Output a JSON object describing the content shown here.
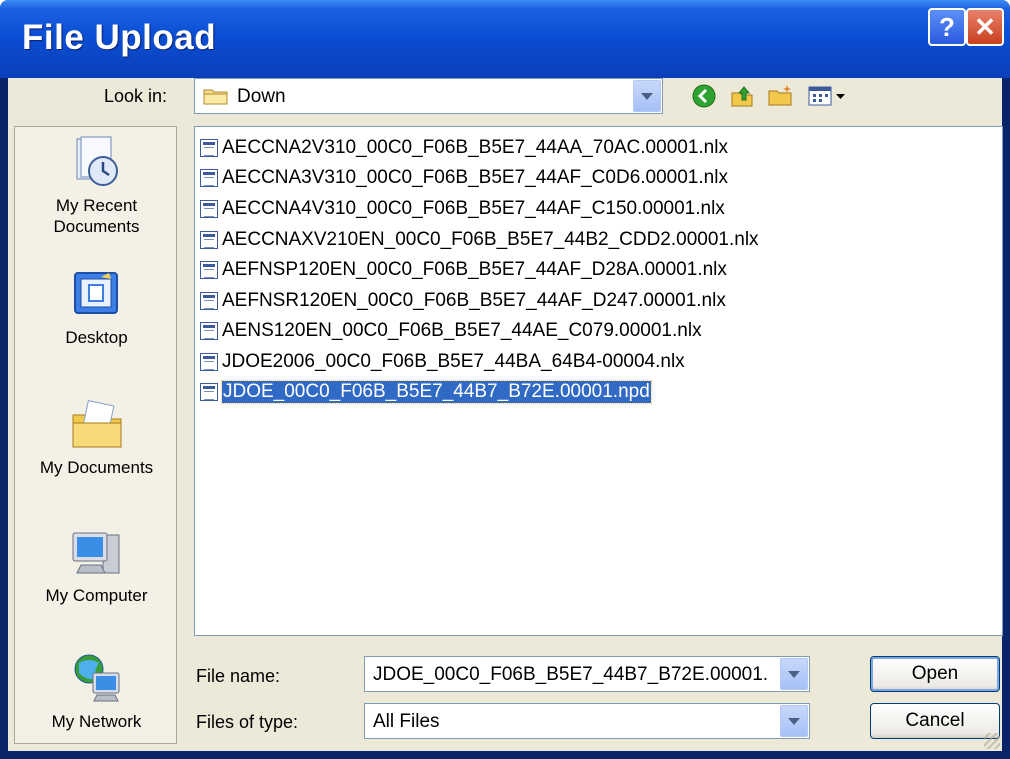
{
  "window": {
    "title": "File Upload",
    "help_label": "?",
    "close_label": "✕"
  },
  "lookin": {
    "label": "Look in:",
    "value": "Down"
  },
  "places": [
    {
      "label": "My Recent Documents",
      "icon": "recent-documents-icon"
    },
    {
      "label": "Desktop",
      "icon": "desktop-icon"
    },
    {
      "label": "My Documents",
      "icon": "my-documents-icon"
    },
    {
      "label": "My Computer",
      "icon": "my-computer-icon"
    },
    {
      "label": "My Network",
      "icon": "my-network-icon"
    }
  ],
  "files": [
    "AECCNA2V310_00C0_F06B_B5E7_44AA_70AC.00001.nlx",
    "AECCNA3V310_00C0_F06B_B5E7_44AF_C0D6.00001.nlx",
    "AECCNA4V310_00C0_F06B_B5E7_44AF_C150.00001.nlx",
    "AECCNAXV210EN_00C0_F06B_B5E7_44B2_CDD2.00001.nlx",
    "AEFNSP120EN_00C0_F06B_B5E7_44AF_D28A.00001.nlx",
    "AEFNSR120EN_00C0_F06B_B5E7_44AF_D247.00001.nlx",
    "AENS120EN_00C0_F06B_B5E7_44AE_C079.00001.nlx",
    "JDOE2006_00C0_F06B_B5E7_44BA_64B4-00004.nlx",
    "JDOE_00C0_F06B_B5E7_44B7_B72E.00001.npd"
  ],
  "selected_file_index": 8,
  "filename": {
    "label": "File name:",
    "value": "JDOE_00C0_F06B_B5E7_44B7_B72E.00001."
  },
  "filetype": {
    "label": "Files of type:",
    "value": "All Files"
  },
  "buttons": {
    "open": "Open",
    "cancel": "Cancel"
  },
  "colors": {
    "title_bar": "#0a4fd4",
    "selection": "#316ac5",
    "dialog_bg": "#ece9d8"
  }
}
